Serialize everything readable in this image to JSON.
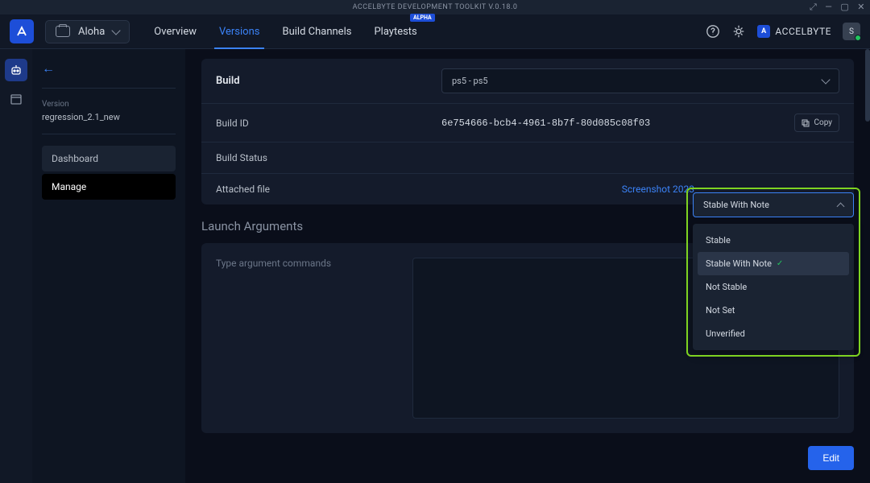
{
  "titlebar": {
    "title": "ACCELBYTE DEVELOPMENT TOOLKIT V.0.18.0"
  },
  "topbar": {
    "logo_text": "A",
    "game_name": "Aloha",
    "tabs": {
      "overview": "Overview",
      "versions": "Versions",
      "build_channels": "Build Channels",
      "playtests": "Playtests"
    },
    "alpha_badge": "ALPHA",
    "brand": "ACCELBYTE",
    "avatar_initial": "S"
  },
  "sidebar": {
    "version_label": "Version",
    "version_value": "regression_2.1_new",
    "items": {
      "dashboard": "Dashboard",
      "manage": "Manage"
    }
  },
  "build": {
    "title": "Build",
    "platform": "ps5 - ps5",
    "id_label": "Build ID",
    "id_value": "6e754666-bcb4-4961-8b7f-80d085c08f03",
    "copy_label": "Copy",
    "status_label": "Build Status",
    "status_value": "Stable With Note",
    "file_label": "Attached file",
    "file_value": "Screenshot 2023"
  },
  "launch": {
    "title": "Launch Arguments",
    "placeholder": "Type argument commands"
  },
  "dropdown": {
    "selected": "Stable With Note",
    "options": {
      "stable": "Stable",
      "stable_note": "Stable With Note",
      "not_stable": "Not Stable",
      "not_set": "Not Set",
      "unverified": "Unverified"
    }
  },
  "buttons": {
    "edit": "Edit"
  }
}
